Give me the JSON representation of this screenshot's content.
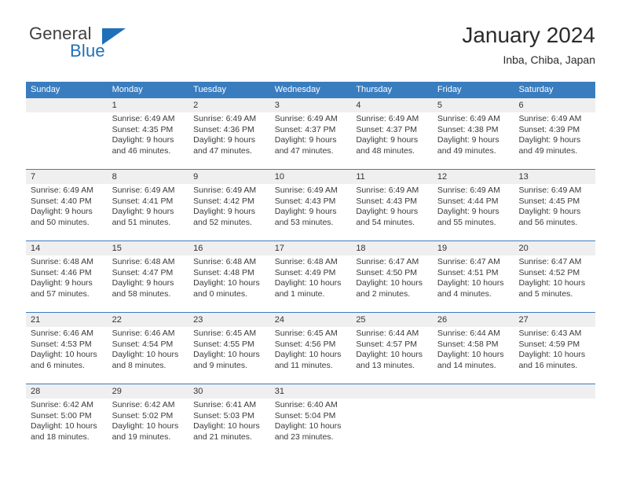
{
  "brand": {
    "word_one": "General",
    "word_two": "Blue",
    "accent_color": "#1f70b8"
  },
  "header": {
    "title": "January 2024",
    "subtitle": "Inba, Chiba, Japan"
  },
  "theme": {
    "header_bar_color": "#3a7dbf",
    "date_row_color": "#efefef",
    "text_color": "#3a3a3a"
  },
  "calendar": {
    "weekday_headers": [
      "Sunday",
      "Monday",
      "Tuesday",
      "Wednesday",
      "Thursday",
      "Friday",
      "Saturday"
    ],
    "weeks": [
      [
        {
          "day": "",
          "lines": []
        },
        {
          "day": "1",
          "lines": [
            "Sunrise: 6:49 AM",
            "Sunset: 4:35 PM",
            "Daylight: 9 hours",
            "and 46 minutes."
          ]
        },
        {
          "day": "2",
          "lines": [
            "Sunrise: 6:49 AM",
            "Sunset: 4:36 PM",
            "Daylight: 9 hours",
            "and 47 minutes."
          ]
        },
        {
          "day": "3",
          "lines": [
            "Sunrise: 6:49 AM",
            "Sunset: 4:37 PM",
            "Daylight: 9 hours",
            "and 47 minutes."
          ]
        },
        {
          "day": "4",
          "lines": [
            "Sunrise: 6:49 AM",
            "Sunset: 4:37 PM",
            "Daylight: 9 hours",
            "and 48 minutes."
          ]
        },
        {
          "day": "5",
          "lines": [
            "Sunrise: 6:49 AM",
            "Sunset: 4:38 PM",
            "Daylight: 9 hours",
            "and 49 minutes."
          ]
        },
        {
          "day": "6",
          "lines": [
            "Sunrise: 6:49 AM",
            "Sunset: 4:39 PM",
            "Daylight: 9 hours",
            "and 49 minutes."
          ]
        }
      ],
      [
        {
          "day": "7",
          "lines": [
            "Sunrise: 6:49 AM",
            "Sunset: 4:40 PM",
            "Daylight: 9 hours",
            "and 50 minutes."
          ]
        },
        {
          "day": "8",
          "lines": [
            "Sunrise: 6:49 AM",
            "Sunset: 4:41 PM",
            "Daylight: 9 hours",
            "and 51 minutes."
          ]
        },
        {
          "day": "9",
          "lines": [
            "Sunrise: 6:49 AM",
            "Sunset: 4:42 PM",
            "Daylight: 9 hours",
            "and 52 minutes."
          ]
        },
        {
          "day": "10",
          "lines": [
            "Sunrise: 6:49 AM",
            "Sunset: 4:43 PM",
            "Daylight: 9 hours",
            "and 53 minutes."
          ]
        },
        {
          "day": "11",
          "lines": [
            "Sunrise: 6:49 AM",
            "Sunset: 4:43 PM",
            "Daylight: 9 hours",
            "and 54 minutes."
          ]
        },
        {
          "day": "12",
          "lines": [
            "Sunrise: 6:49 AM",
            "Sunset: 4:44 PM",
            "Daylight: 9 hours",
            "and 55 minutes."
          ]
        },
        {
          "day": "13",
          "lines": [
            "Sunrise: 6:49 AM",
            "Sunset: 4:45 PM",
            "Daylight: 9 hours",
            "and 56 minutes."
          ]
        }
      ],
      [
        {
          "day": "14",
          "lines": [
            "Sunrise: 6:48 AM",
            "Sunset: 4:46 PM",
            "Daylight: 9 hours",
            "and 57 minutes."
          ]
        },
        {
          "day": "15",
          "lines": [
            "Sunrise: 6:48 AM",
            "Sunset: 4:47 PM",
            "Daylight: 9 hours",
            "and 58 minutes."
          ]
        },
        {
          "day": "16",
          "lines": [
            "Sunrise: 6:48 AM",
            "Sunset: 4:48 PM",
            "Daylight: 10 hours",
            "and 0 minutes."
          ]
        },
        {
          "day": "17",
          "lines": [
            "Sunrise: 6:48 AM",
            "Sunset: 4:49 PM",
            "Daylight: 10 hours",
            "and 1 minute."
          ]
        },
        {
          "day": "18",
          "lines": [
            "Sunrise: 6:47 AM",
            "Sunset: 4:50 PM",
            "Daylight: 10 hours",
            "and 2 minutes."
          ]
        },
        {
          "day": "19",
          "lines": [
            "Sunrise: 6:47 AM",
            "Sunset: 4:51 PM",
            "Daylight: 10 hours",
            "and 4 minutes."
          ]
        },
        {
          "day": "20",
          "lines": [
            "Sunrise: 6:47 AM",
            "Sunset: 4:52 PM",
            "Daylight: 10 hours",
            "and 5 minutes."
          ]
        }
      ],
      [
        {
          "day": "21",
          "lines": [
            "Sunrise: 6:46 AM",
            "Sunset: 4:53 PM",
            "Daylight: 10 hours",
            "and 6 minutes."
          ]
        },
        {
          "day": "22",
          "lines": [
            "Sunrise: 6:46 AM",
            "Sunset: 4:54 PM",
            "Daylight: 10 hours",
            "and 8 minutes."
          ]
        },
        {
          "day": "23",
          "lines": [
            "Sunrise: 6:45 AM",
            "Sunset: 4:55 PM",
            "Daylight: 10 hours",
            "and 9 minutes."
          ]
        },
        {
          "day": "24",
          "lines": [
            "Sunrise: 6:45 AM",
            "Sunset: 4:56 PM",
            "Daylight: 10 hours",
            "and 11 minutes."
          ]
        },
        {
          "day": "25",
          "lines": [
            "Sunrise: 6:44 AM",
            "Sunset: 4:57 PM",
            "Daylight: 10 hours",
            "and 13 minutes."
          ]
        },
        {
          "day": "26",
          "lines": [
            "Sunrise: 6:44 AM",
            "Sunset: 4:58 PM",
            "Daylight: 10 hours",
            "and 14 minutes."
          ]
        },
        {
          "day": "27",
          "lines": [
            "Sunrise: 6:43 AM",
            "Sunset: 4:59 PM",
            "Daylight: 10 hours",
            "and 16 minutes."
          ]
        }
      ],
      [
        {
          "day": "28",
          "lines": [
            "Sunrise: 6:42 AM",
            "Sunset: 5:00 PM",
            "Daylight: 10 hours",
            "and 18 minutes."
          ]
        },
        {
          "day": "29",
          "lines": [
            "Sunrise: 6:42 AM",
            "Sunset: 5:02 PM",
            "Daylight: 10 hours",
            "and 19 minutes."
          ]
        },
        {
          "day": "30",
          "lines": [
            "Sunrise: 6:41 AM",
            "Sunset: 5:03 PM",
            "Daylight: 10 hours",
            "and 21 minutes."
          ]
        },
        {
          "day": "31",
          "lines": [
            "Sunrise: 6:40 AM",
            "Sunset: 5:04 PM",
            "Daylight: 10 hours",
            "and 23 minutes."
          ]
        },
        {
          "day": "",
          "lines": []
        },
        {
          "day": "",
          "lines": []
        },
        {
          "day": "",
          "lines": []
        }
      ]
    ]
  }
}
